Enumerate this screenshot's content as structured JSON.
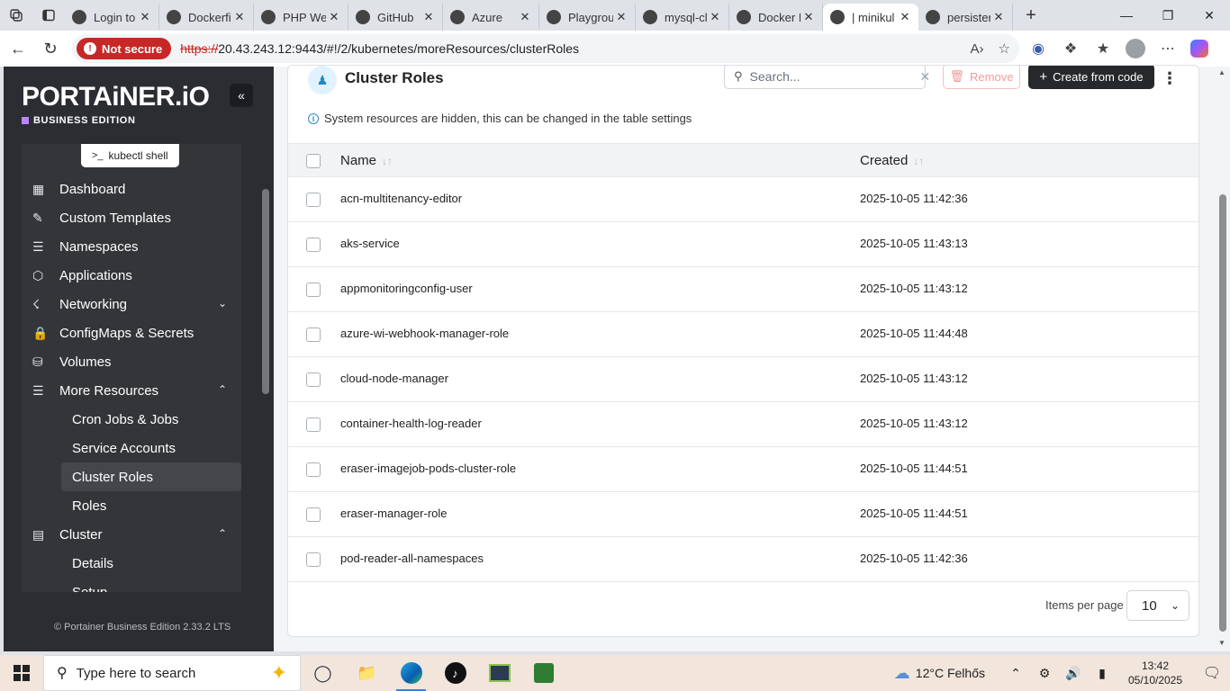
{
  "browser": {
    "tabs": [
      {
        "title": "Login to",
        "icon": "gear-favicon",
        "active": false
      },
      {
        "title": "Dockerfi",
        "icon": "github-favicon",
        "active": false
      },
      {
        "title": "PHP Wel",
        "icon": "github-favicon",
        "active": false
      },
      {
        "title": "GitHub",
        "icon": "github-favicon",
        "active": false
      },
      {
        "title": "Azure",
        "icon": "azure-favicon",
        "active": false
      },
      {
        "title": "Playgrou",
        "icon": "cloud-favicon",
        "active": false
      },
      {
        "title": "mysql-cl",
        "icon": "azure-favicon",
        "active": false
      },
      {
        "title": "Docker I",
        "icon": "docker-favicon",
        "active": false
      },
      {
        "title": "| minikul",
        "icon": "portainer-favicon",
        "active": true
      },
      {
        "title": "persister",
        "icon": "search-favicon",
        "active": false
      }
    ],
    "not_secure_label": "Not secure",
    "url_scheme": "https://",
    "url_rest": "20.43.243.12:9443/#!/2/kubernetes/moreResources/clusterRoles"
  },
  "sidebar": {
    "brand": "PORTAiNER.iO",
    "edition": "BUSINESS EDITION",
    "kubectl_label": "kubectl shell",
    "items": [
      {
        "label": "Dashboard",
        "icon": "dashboard-icon"
      },
      {
        "label": "Custom Templates",
        "icon": "edit-icon"
      },
      {
        "label": "Namespaces",
        "icon": "layers-icon"
      },
      {
        "label": "Applications",
        "icon": "box-icon"
      },
      {
        "label": "Networking",
        "icon": "network-icon"
      },
      {
        "label": "ConfigMaps & Secrets",
        "icon": "lock-icon"
      },
      {
        "label": "Volumes",
        "icon": "database-icon"
      },
      {
        "label": "More Resources",
        "icon": "list-icon"
      }
    ],
    "more_resources_children": [
      "Cron Jobs & Jobs",
      "Service Accounts",
      "Cluster Roles",
      "Roles"
    ],
    "cluster_label": "Cluster",
    "cluster_children": [
      "Details",
      "Setup"
    ],
    "footer": "Portainer Business Edition 2.33.2 LTS"
  },
  "main": {
    "title": "Cluster Roles",
    "search_placeholder": "Search...",
    "remove_label": "Remove",
    "create_label": "Create from code",
    "info_text": "System resources are hidden, this can be changed in the table settings",
    "columns": [
      "Name",
      "Created"
    ],
    "rows": [
      {
        "name": "acn-multitenancy-editor",
        "created": "2025-10-05 11:42:36"
      },
      {
        "name": "aks-service",
        "created": "2025-10-05 11:43:13"
      },
      {
        "name": "appmonitoringconfig-user",
        "created": "2025-10-05 11:43:12"
      },
      {
        "name": "azure-wi-webhook-manager-role",
        "created": "2025-10-05 11:44:48"
      },
      {
        "name": "cloud-node-manager",
        "created": "2025-10-05 11:43:12"
      },
      {
        "name": "container-health-log-reader",
        "created": "2025-10-05 11:43:12"
      },
      {
        "name": "eraser-imagejob-pods-cluster-role",
        "created": "2025-10-05 11:44:51"
      },
      {
        "name": "eraser-manager-role",
        "created": "2025-10-05 11:44:51"
      },
      {
        "name": "pod-reader-all-namespaces",
        "created": "2025-10-05 11:42:36"
      }
    ],
    "items_per_page_label": "Items per page",
    "items_per_page_value": "10"
  },
  "taskbar": {
    "search_placeholder": "Type here to search",
    "weather": "12°C  Felhős",
    "time": "13:42",
    "date": "05/10/2025"
  }
}
